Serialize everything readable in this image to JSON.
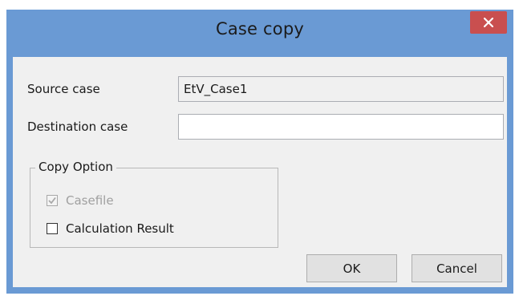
{
  "window": {
    "title": "Case copy",
    "close_icon": "close-icon"
  },
  "form": {
    "source_label": "Source case",
    "source_value": "EtV_Case1",
    "destination_label": "Destination case",
    "destination_value": ""
  },
  "copy_option": {
    "legend": "Copy Option",
    "casefile_label": "Casefile",
    "casefile_checked": true,
    "casefile_enabled": false,
    "calc_result_label": "Calculation Result",
    "calc_result_checked": false
  },
  "buttons": {
    "ok_label": "OK",
    "cancel_label": "Cancel"
  },
  "colors": {
    "titlebar": "#6a9ad4",
    "close_button": "#c94f4f",
    "client_background": "#f0f0f0"
  }
}
